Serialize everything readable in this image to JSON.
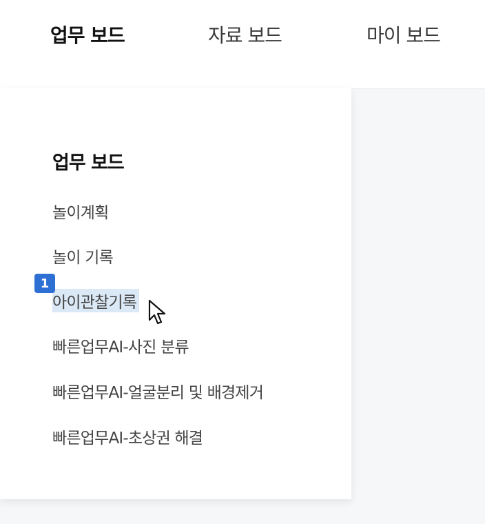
{
  "topnav": {
    "tabs": [
      {
        "label": "업무 보드",
        "active": true
      },
      {
        "label": "자료 보드",
        "active": false
      },
      {
        "label": "마이 보드",
        "active": false
      }
    ]
  },
  "dropdown": {
    "heading": "업무 보드",
    "items": [
      {
        "label": "놀이계획"
      },
      {
        "label": "놀이 기록"
      },
      {
        "label": "아이관찰기록",
        "highlighted": true
      },
      {
        "label": "빠른업무AI-사진 분류"
      },
      {
        "label": "빠른업무AI-얼굴분리 및 배경제거"
      },
      {
        "label": "빠른업무AI-초상권 해결"
      }
    ]
  },
  "marker": {
    "label": "1"
  },
  "colors": {
    "highlight": "#dbe8f6",
    "marker": "#2e6fd3",
    "content_bg": "#f5f7f9"
  },
  "cursor": {
    "icon": "arrow-pointer-icon"
  }
}
